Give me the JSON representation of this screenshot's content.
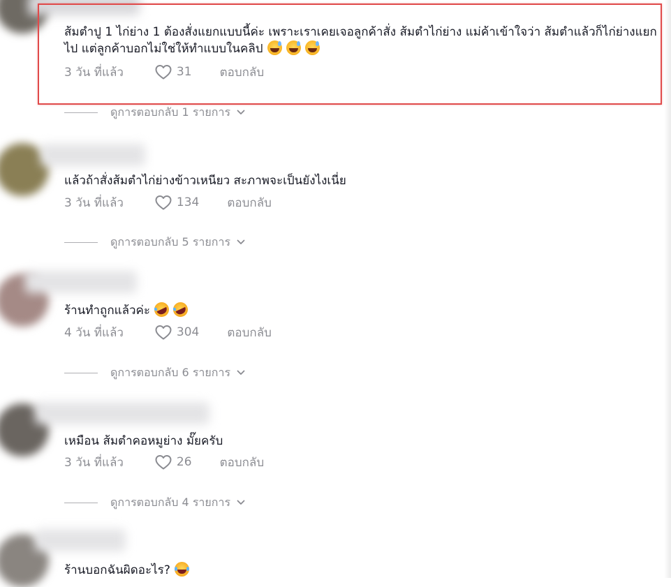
{
  "comments": [
    {
      "text": "ส้มตำปู 1 ไก่ย่าง 1 ต้องสั่งแยกแบบนี้ค่ะ เพราะเราเคยเจอลูกค้าสั่ง ส้มตำไก่ย่าง แม่ค้าเข้าใจว่า ส้มตำแล้วก็ไก่ย่างแยกไป แต่ลูกค้าบอกไม่ใช่ให้ทำแบบในคลิป",
      "emojis": [
        "smiling-face-with-sweat",
        "smiling-face-with-sweat",
        "smiling-face-with-sweat"
      ],
      "time": "3 วัน ที่แล้ว",
      "likes": "31",
      "reply_label": "ตอบกลับ",
      "view_replies": "ดูการตอบกลับ 1 รายการ",
      "highlighted": true
    },
    {
      "text": "แล้วถ้าสั่งส้มตำไก่ย่างข้าวเหนียว สะภาพจะเป็นยังไงเนี่ย",
      "time": "3 วัน ที่แล้ว",
      "likes": "134",
      "reply_label": "ตอบกลับ",
      "view_replies": "ดูการตอบกลับ 5 รายการ"
    },
    {
      "text": "ร้านทำถูกแล้วค่ะ",
      "emojis": [
        "rolling-on-floor-laughing",
        "rolling-on-floor-laughing"
      ],
      "time": "4 วัน ที่แล้ว",
      "likes": "304",
      "reply_label": "ตอบกลับ",
      "view_replies": "ดูการตอบกลับ 6 รายการ"
    },
    {
      "text": "เหมือน ส้มตำคอหมูย่าง มั๊ยครับ",
      "time": "3 วัน ที่แล้ว",
      "likes": "26",
      "reply_label": "ตอบกลับ",
      "view_replies": "ดูการตอบกลับ 4 รายการ"
    },
    {
      "text": "ร้านบอกฉันผิดอะไร?",
      "emojis": [
        "face-with-tears-of-joy"
      ]
    }
  ],
  "colors": {
    "text": "#161823",
    "muted": "#8a8b91",
    "highlight_border": "#e04a4a"
  },
  "icons": {
    "like": "heart-outline-icon",
    "expand": "chevron-down-icon"
  }
}
